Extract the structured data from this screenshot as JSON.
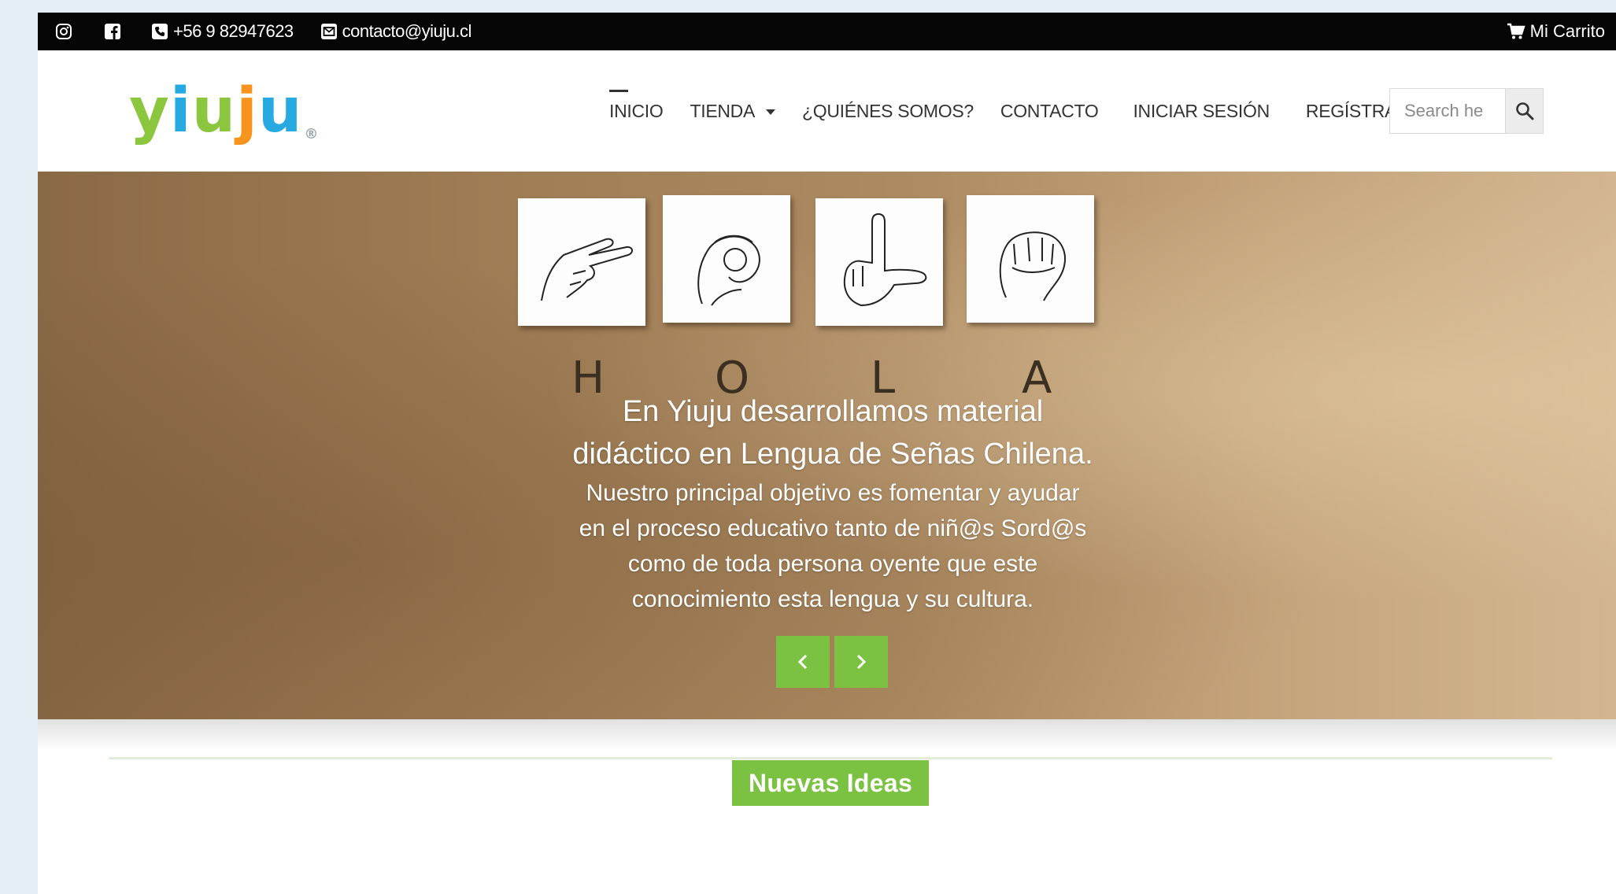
{
  "topbar": {
    "phone": "+56 9 82947623",
    "email": "contacto@yiuju.cl",
    "cart_label": "Mi Carrito"
  },
  "logo": {
    "text": "yiuju",
    "letters": [
      "y",
      "i",
      "u",
      "j",
      "u"
    ],
    "trademark": "®"
  },
  "nav": {
    "items": [
      {
        "label": "INICIO",
        "active": true
      },
      {
        "label": "TIENDA",
        "dropdown": true
      },
      {
        "label": "¿QUIÉNES SOMOS?"
      },
      {
        "label": "CONTACTO"
      },
      {
        "label": "INICIAR SESIÓN"
      },
      {
        "label": "REGÍSTRATE"
      }
    ]
  },
  "search": {
    "placeholder": "Search he"
  },
  "hero": {
    "letters": [
      "H",
      "O",
      "L",
      "A"
    ],
    "title_line1": "En Yiuju desarrollamos material",
    "title_line2": "didáctico en Lengua de Señas Chilena.",
    "body_line1": "Nuestro principal objetivo es fomentar y ayudar",
    "body_line2": "en el proceso educativo tanto de niñ@s Sord@s",
    "body_line3": "como de toda persona oyente que este",
    "body_line4": "conocimiento esta lengua y su cultura."
  },
  "section": {
    "title": "Nuevas Ideas"
  },
  "colors": {
    "accent_green": "#7cc242",
    "topbar": "#050505",
    "logo_y": "#8cc63f",
    "logo_i": "#27a9e1",
    "logo_u1": "#8cc63f",
    "logo_j": "#f7941d",
    "logo_u2": "#27a9e1"
  },
  "icons": [
    "instagram-icon",
    "facebook-icon",
    "phone-icon",
    "email-icon",
    "cart-icon",
    "search-icon",
    "chevron-left-icon",
    "chevron-right-icon"
  ]
}
